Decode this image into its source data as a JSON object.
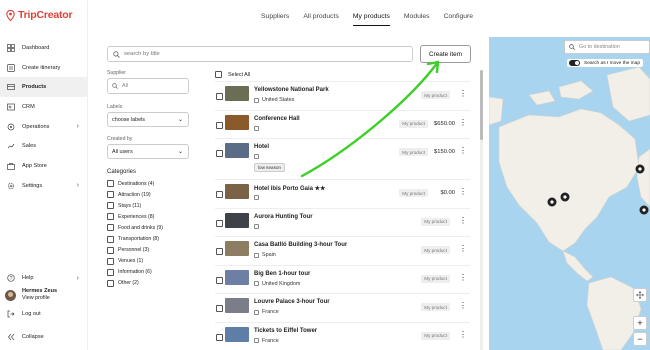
{
  "brand": {
    "name": "TripCreator",
    "color": "#e0403a"
  },
  "sidebar": {
    "items": [
      {
        "label": "Dashboard",
        "icon": "dashboard-icon"
      },
      {
        "label": "Create itinerary",
        "icon": "itinerary-icon"
      },
      {
        "label": "Products",
        "icon": "products-icon",
        "active": true
      },
      {
        "label": "CRM",
        "icon": "crm-icon"
      },
      {
        "label": "Operations",
        "icon": "operations-icon",
        "chevron": true
      },
      {
        "label": "Sales",
        "icon": "sales-icon"
      },
      {
        "label": "App Store",
        "icon": "store-icon"
      },
      {
        "label": "Settings",
        "icon": "gear-icon",
        "chevron": true
      }
    ],
    "help": "Help",
    "user": {
      "name": "Hermes Zeus",
      "profile_link": "View profile"
    },
    "logout": "Log out",
    "collapse": "Collapse"
  },
  "topnav": {
    "tabs": [
      "Suppliers",
      "All products",
      "My products",
      "Modules",
      "Configure"
    ],
    "active": "My products"
  },
  "search": {
    "placeholder": "search by title"
  },
  "create_button": "Create item",
  "filters": {
    "supplier_label": "Supplier",
    "supplier_placeholder": "All",
    "labels_label": "Labels",
    "labels_value": "choose labels",
    "created_by_label": "Created by",
    "created_by_value": "All users",
    "categories_title": "Categories",
    "categories": [
      "Destinations (4)",
      "Attraction (19)",
      "Stays (11)",
      "Experiences (8)",
      "Food and drinks (9)",
      "Transportation (8)",
      "Personnel (3)",
      "Venues (1)",
      "Information (6)",
      "Other (2)"
    ]
  },
  "list": {
    "select_all": "Select All",
    "badge": "My product",
    "rows": [
      {
        "title": "Yellowstone National Park",
        "sub": "United States",
        "thumb": "#6b6e55",
        "price": ""
      },
      {
        "title": "Conference Hall",
        "sub": "",
        "thumb": "#8a5a2a",
        "price": "$650.00"
      },
      {
        "title": "Hotel",
        "sub": "",
        "thumb": "#5b6c86",
        "price": "$150.00",
        "tag": "low season"
      },
      {
        "title": "Hotel ibis Porto Gaia ★★",
        "sub": "",
        "thumb": "#7a6247",
        "price": "$0.00"
      },
      {
        "title": "Aurora Hunting Tour",
        "sub": "",
        "thumb": "#3f4248",
        "price": ""
      },
      {
        "title": "Casa Batlló Building 3-hour Tour",
        "sub": "Spain",
        "thumb": "#8d7d62",
        "price": ""
      },
      {
        "title": "Big Ben 1-hour tour",
        "sub": "United Kingdom",
        "thumb": "#6d7fa5",
        "price": ""
      },
      {
        "title": "Louvre Palace 3-hour Tour",
        "sub": "France",
        "thumb": "#7b7d88",
        "price": ""
      },
      {
        "title": "Tickets to Eiffel Tower",
        "sub": "France",
        "thumb": "#5e7ea8",
        "price": ""
      }
    ]
  },
  "map": {
    "search_placeholder": "Go to destination",
    "toggle_label": "Search as I move the map",
    "zoom_in": "+",
    "zoom_out": "−"
  },
  "annotation": {
    "arrow_color": "#3ecf2a"
  }
}
